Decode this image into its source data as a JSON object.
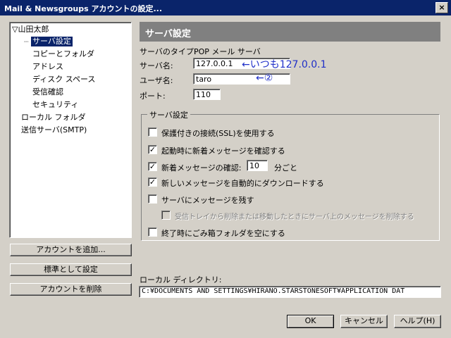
{
  "window": {
    "title": "Mail & Newsgroups アカウントの設定...",
    "close_glyph": "×"
  },
  "tree": {
    "account": "▽山田太郎",
    "server_settings": "サーバ設定",
    "copies_folders": "コピーとフォルダ",
    "address": "アドレス",
    "disk_space": "ディスク スペース",
    "receipts": "受信確認",
    "security": "セキュリティ",
    "local_folders": "ローカル フォルダ",
    "smtp": "送信サーバ(SMTP)"
  },
  "left_buttons": {
    "add": "アカウントを追加...",
    "default": "標準として設定",
    "remove": "アカウントを削除"
  },
  "panel": {
    "title": "サーバ設定",
    "server_type_label": "サーバのタイプ:",
    "server_type_value": "POP メール サーバ",
    "server_name_label": "サーバ名:",
    "server_name_value": "127.0.0.1",
    "username_label": "ユーザ名:",
    "username_value": "taro",
    "port_label": "ポート:",
    "port_value": "110",
    "annotation_server": "←いつも127.0.0.1",
    "annotation_user": "←②"
  },
  "group": {
    "legend": "サーバ設定",
    "ssl": {
      "label": "保護付きの接続(SSL)を使用する",
      "checked": false
    },
    "check_startup": {
      "label": "起動時に新着メッセージを確認する",
      "checked": true
    },
    "check_every": {
      "label": "新着メッセージの確認:",
      "checked": true,
      "minutes": "10",
      "suffix": "分ごと"
    },
    "auto_download": {
      "label": "新しいメッセージを自動的にダウンロードする",
      "checked": true
    },
    "leave_on_server": {
      "label": "サーバにメッセージを残す",
      "checked": false
    },
    "delete_on_move": {
      "label": "受信トレイから削除または移動したときにサーバ上のメッセージを削除する",
      "checked": false,
      "disabled": true
    },
    "empty_trash": {
      "label": "終了時にごみ箱フォルダを空にする",
      "checked": false
    }
  },
  "local_dir": {
    "label": "ローカル ディレクトリ:",
    "value": "C:¥DOCUMENTS AND SETTINGS¥HIRANO.STARSTONESOFT¥APPLICATION DAT"
  },
  "footer": {
    "ok": "OK",
    "cancel": "キャンセル",
    "help": "ヘルプ(H)"
  },
  "colors": {
    "titlebar": "#0a246a",
    "dialog_bg": "#d4d0c8",
    "annotation": "#1f2fc8"
  }
}
